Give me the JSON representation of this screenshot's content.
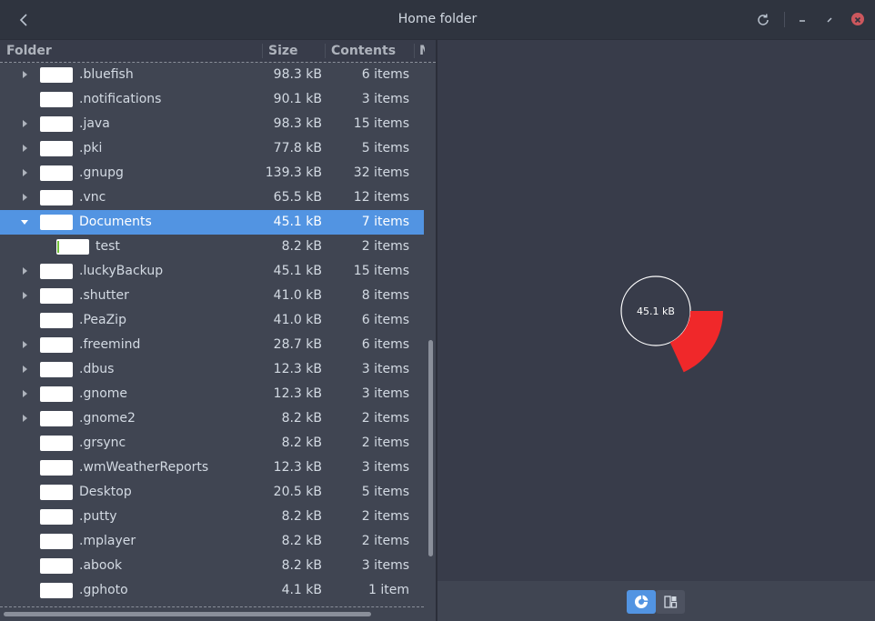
{
  "window": {
    "title": "Home folder"
  },
  "columns": {
    "folder": "Folder",
    "size": "Size",
    "contents": "Contents",
    "modified": "M"
  },
  "rows": [
    {
      "name": ".bluefish",
      "size": "98.3 kB",
      "contents": "6 items",
      "expander": "collapsed"
    },
    {
      "name": ".notifications",
      "size": "90.1 kB",
      "contents": "3 items",
      "expander": "none"
    },
    {
      "name": ".java",
      "size": "98.3 kB",
      "contents": "15 items",
      "expander": "collapsed"
    },
    {
      "name": ".pki",
      "size": "77.8 kB",
      "contents": "5 items",
      "expander": "collapsed"
    },
    {
      "name": ".gnupg",
      "size": "139.3 kB",
      "contents": "32 items",
      "expander": "collapsed"
    },
    {
      "name": ".vnc",
      "size": "65.5 kB",
      "contents": "12 items",
      "expander": "collapsed"
    },
    {
      "name": "Documents",
      "size": "45.1 kB",
      "contents": "7 items",
      "expander": "expanded",
      "selected": true
    },
    {
      "name": "test",
      "size": "8.2 kB",
      "contents": "2 items",
      "expander": "none",
      "child": true
    },
    {
      "name": ".luckyBackup",
      "size": "45.1 kB",
      "contents": "15 items",
      "expander": "collapsed"
    },
    {
      "name": ".shutter",
      "size": "41.0 kB",
      "contents": "8 items",
      "expander": "collapsed"
    },
    {
      "name": ".PeaZip",
      "size": "41.0 kB",
      "contents": "6 items",
      "expander": "none"
    },
    {
      "name": ".freemind",
      "size": "28.7 kB",
      "contents": "6 items",
      "expander": "collapsed"
    },
    {
      "name": ".dbus",
      "size": "12.3 kB",
      "contents": "3 items",
      "expander": "collapsed"
    },
    {
      "name": ".gnome",
      "size": "12.3 kB",
      "contents": "3 items",
      "expander": "collapsed"
    },
    {
      "name": ".gnome2",
      "size": "8.2 kB",
      "contents": "2 items",
      "expander": "collapsed"
    },
    {
      "name": ".grsync",
      "size": "8.2 kB",
      "contents": "2 items",
      "expander": "none"
    },
    {
      "name": ".wmWeatherReports",
      "size": "12.3 kB",
      "contents": "3 items",
      "expander": "none"
    },
    {
      "name": "Desktop",
      "size": "20.5 kB",
      "contents": "5 items",
      "expander": "none"
    },
    {
      "name": ".putty",
      "size": "8.2 kB",
      "contents": "2 items",
      "expander": "none"
    },
    {
      "name": ".mplayer",
      "size": "8.2 kB",
      "contents": "2 items",
      "expander": "none"
    },
    {
      "name": ".abook",
      "size": "8.2 kB",
      "contents": "3 items",
      "expander": "none"
    },
    {
      "name": ".gphoto",
      "size": "4.1 kB",
      "contents": "1 item",
      "expander": "none"
    }
  ],
  "chart": {
    "center_label": "45.1 kB",
    "segment_color": "#f0282a",
    "segment_fraction": 0.182
  },
  "colors": {
    "accent": "#5294e2",
    "close": "#cc575d"
  },
  "icons": {
    "back": "chevron-left-icon",
    "refresh": "refresh-icon",
    "minimize": "minimize-icon",
    "maximize": "maximize-icon",
    "close": "close-icon",
    "ring_view": "ring-chart-icon",
    "treemap_view": "treemap-icon"
  }
}
